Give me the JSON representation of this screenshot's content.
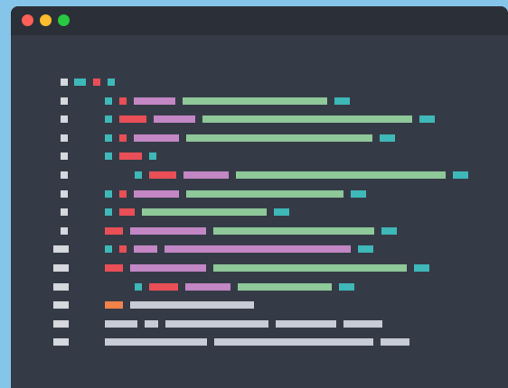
{
  "window": {
    "traffic_lights": [
      {
        "name": "close-button",
        "color": "#fe5f57"
      },
      {
        "name": "minimize-button",
        "color": "#febc2e"
      },
      {
        "name": "zoom-button",
        "color": "#28c840"
      }
    ]
  },
  "colors": {
    "teal": "#3fb8b9",
    "red": "#ea4f57",
    "purple": "#c487c6",
    "green": "#8fc99a",
    "gray": "#c7ccd6",
    "orange": "#f0824a",
    "linenum": "#d6d9de"
  },
  "code_lines": [
    {
      "num": "short",
      "tokens": [
        [
          "teal",
          13
        ],
        [
          "red",
          8
        ],
        [
          "teal",
          8
        ]
      ]
    },
    {
      "num": "short",
      "tokens": [
        [
          "teal",
          8
        ],
        [
          "red",
          8
        ],
        [
          "purple",
          46
        ],
        [
          "green",
          160
        ],
        [
          "teal",
          17
        ]
      ]
    },
    {
      "num": "short",
      "tokens": [
        [
          "teal",
          8
        ],
        [
          "red",
          30
        ],
        [
          "purple",
          46
        ],
        [
          "green",
          232
        ],
        [
          "teal",
          17
        ]
      ]
    },
    {
      "num": "short",
      "tokens": [
        [
          "teal",
          8
        ],
        [
          "red",
          8
        ],
        [
          "purple",
          50
        ],
        [
          "green",
          206
        ],
        [
          "teal",
          17
        ]
      ]
    },
    {
      "num": "short",
      "tokens": [
        [
          "teal",
          8
        ],
        [
          "red",
          25
        ],
        [
          "teal",
          8
        ]
      ]
    },
    {
      "num": "short",
      "indent": 1,
      "tokens": [
        [
          "teal",
          8
        ],
        [
          "red",
          30
        ],
        [
          "purple",
          50
        ],
        [
          "green",
          232
        ],
        [
          "teal",
          17
        ]
      ]
    },
    {
      "num": "short",
      "tokens": [
        [
          "teal",
          8
        ],
        [
          "red",
          8
        ],
        [
          "purple",
          50
        ],
        [
          "green",
          174
        ],
        [
          "teal",
          17
        ]
      ]
    },
    {
      "num": "short",
      "tokens": [
        [
          "teal",
          8
        ],
        [
          "red",
          17
        ],
        [
          "green",
          138
        ],
        [
          "teal",
          17
        ]
      ]
    },
    {
      "num": "short",
      "tokens": [
        [
          "red",
          20
        ],
        [
          "purple",
          84
        ],
        [
          "green",
          178
        ],
        [
          "teal",
          17
        ]
      ]
    },
    {
      "num": "long",
      "tokens": [
        [
          "teal",
          8
        ],
        [
          "red",
          8
        ],
        [
          "purple",
          26
        ],
        [
          "purple",
          206
        ],
        [
          "teal",
          17
        ]
      ]
    },
    {
      "num": "long",
      "tokens": [
        [
          "red",
          20
        ],
        [
          "purple",
          84
        ],
        [
          "green",
          214
        ],
        [
          "teal",
          17
        ]
      ]
    },
    {
      "num": "long",
      "indent": 1,
      "tokens": [
        [
          "teal",
          8
        ],
        [
          "red",
          32
        ],
        [
          "purple",
          50
        ],
        [
          "green",
          104
        ],
        [
          "teal",
          17
        ]
      ]
    },
    {
      "num": "long",
      "tokens": [
        [
          "orange",
          20
        ],
        [
          "gray",
          137
        ]
      ]
    },
    {
      "num": "long",
      "tokens": [
        [
          "gray",
          36
        ],
        [
          "gray",
          15
        ],
        [
          "gray",
          114
        ],
        [
          "gray",
          67
        ],
        [
          "gray",
          43
        ]
      ]
    },
    {
      "num": "long",
      "tokens": [
        [
          "gray",
          113
        ],
        [
          "gray",
          176
        ],
        [
          "gray",
          32
        ]
      ]
    }
  ]
}
